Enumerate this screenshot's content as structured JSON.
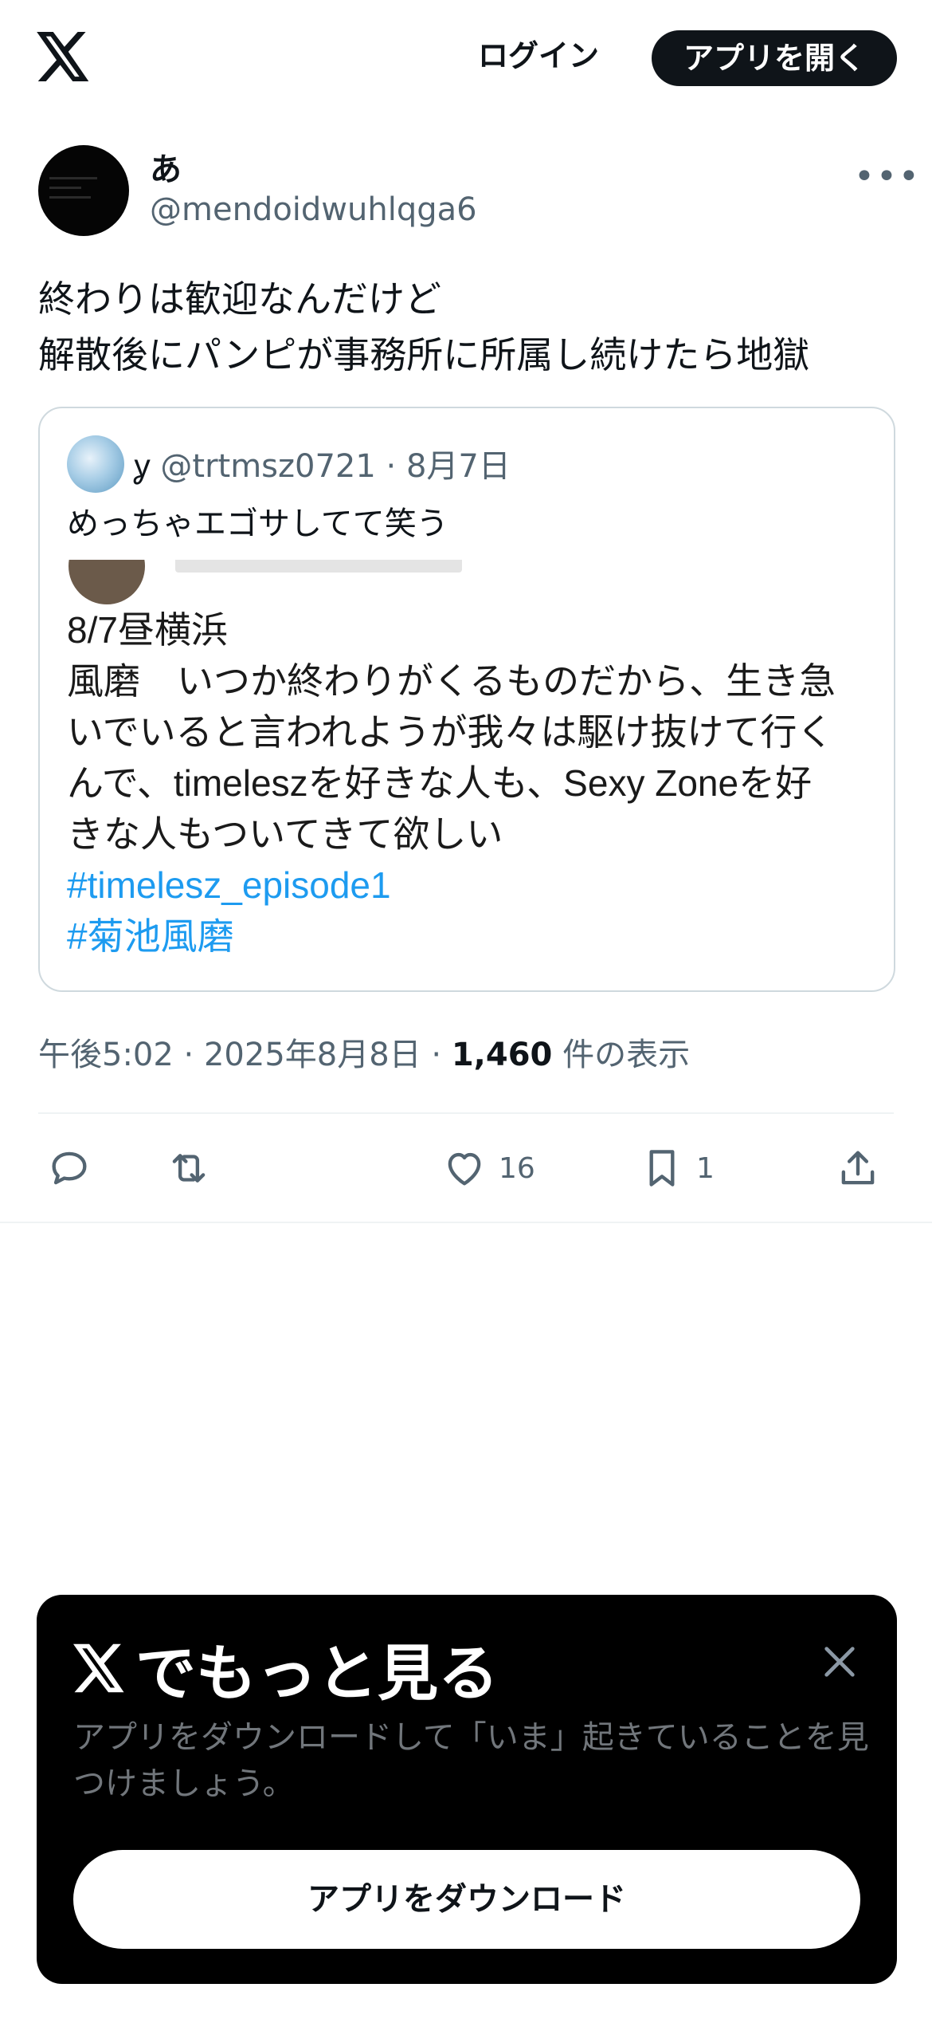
{
  "header": {
    "logo_icon": "x-logo-icon",
    "login_label": "ログイン",
    "open_app_label": "アプリを開く"
  },
  "tweet": {
    "author_name": "あ",
    "author_handle": "@mendoidwuhlqga6",
    "more_icon": "more-icon",
    "text_line1": "終わりは歓迎なんだけど",
    "text_line2": "解散後にパンピが事務所に所属し続けたら地獄",
    "quote": {
      "name": "ỿ",
      "handle": "@trtmsz0721",
      "date": "8月7日",
      "text": "めっちゃエゴサしてて笑う",
      "image_lines": [
        "8/7昼横浜",
        "風磨　いつか終わりがくるものだから、生き急",
        "いでいると言われようが我々は駆け抜けて行く",
        "んで、timeleszを好きな人も、Sexy Zoneを好",
        "きな人もついてきて欲しい"
      ],
      "hashtag1": "#timelesz_episode1",
      "hashtag2": "#菊池風磨"
    },
    "time": "午後5:02",
    "date": "2025年8月8日",
    "views_count": "1,460",
    "views_label": "件の表示",
    "actions": {
      "reply_icon": "reply-icon",
      "retweet_icon": "retweet-icon",
      "like_icon": "heart-icon",
      "like_count": "16",
      "bookmark_icon": "bookmark-icon",
      "bookmark_count": "1",
      "share_icon": "share-icon"
    }
  },
  "promo": {
    "title": "でもっと見る",
    "description": "アプリをダウンロードして「いま」起きていることを見つけましょう。",
    "download_label": "アプリをダウンロード"
  },
  "colors": {
    "text_primary": "#0f1419",
    "text_secondary": "#536471",
    "link": "#1d9bf0",
    "border": "#cfd9de",
    "promo_bg": "#000000"
  }
}
